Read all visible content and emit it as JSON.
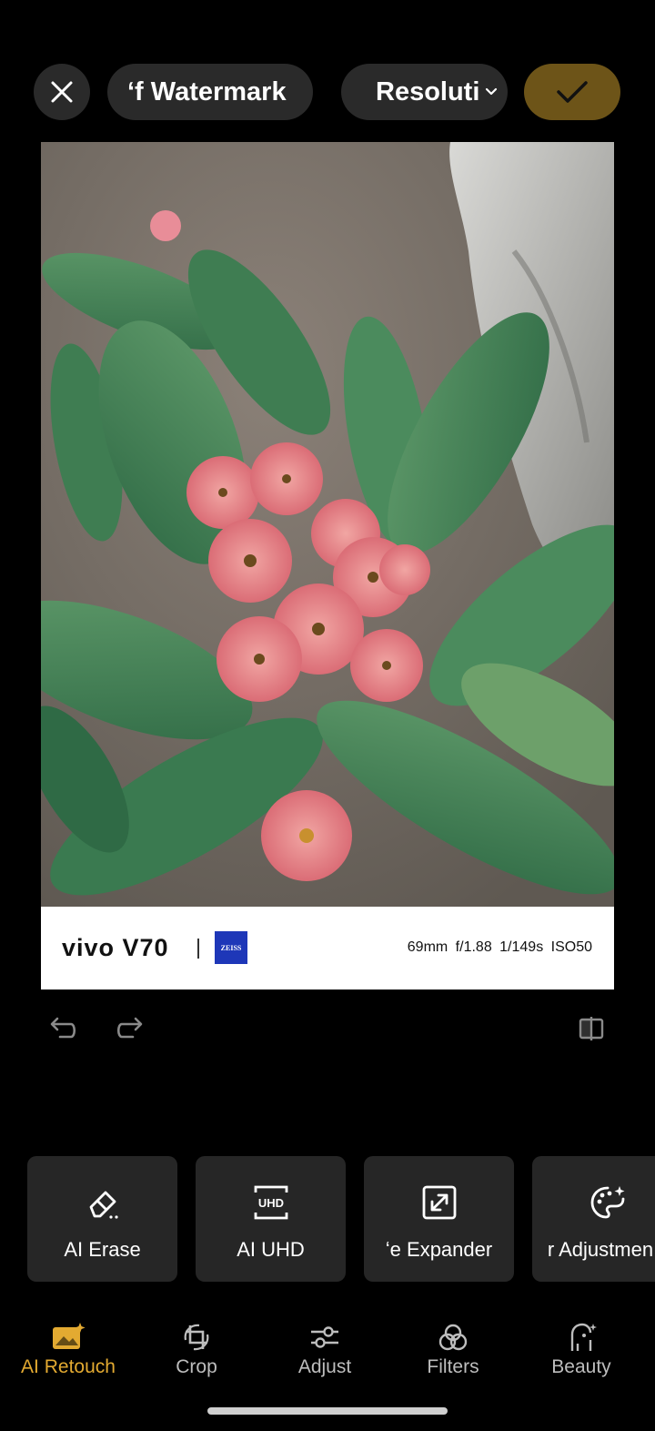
{
  "topbar": {
    "close_icon": "close-icon",
    "watermark_label": "ʻf Watermark",
    "resolution_label": "Resoluti",
    "confirm_icon": "check-icon",
    "accent": "#6d5418"
  },
  "photo": {
    "watermark": {
      "brand": "vivo V70",
      "logo_text": "ZEISS",
      "exif": "69mm f/1.88 1/149s ISO50"
    }
  },
  "history": {
    "undo_icon": "undo-icon",
    "redo_icon": "redo-icon",
    "compare_icon": "compare-icon"
  },
  "tools": [
    {
      "label": "AI Erase",
      "icon": "eraser-icon"
    },
    {
      "label": "AI UHD",
      "icon": "uhd-icon"
    },
    {
      "label": "ʻe Expander",
      "icon": "expand-icon"
    },
    {
      "label": "r Adjustmen",
      "icon": "palette-icon"
    }
  ],
  "nav": {
    "active_color": "#e3aa31",
    "items": [
      {
        "label": "AI Retouch",
        "active": true
      },
      {
        "label": "Crop"
      },
      {
        "label": "Adjust"
      },
      {
        "label": "Filters"
      },
      {
        "label": "Beauty"
      }
    ]
  }
}
